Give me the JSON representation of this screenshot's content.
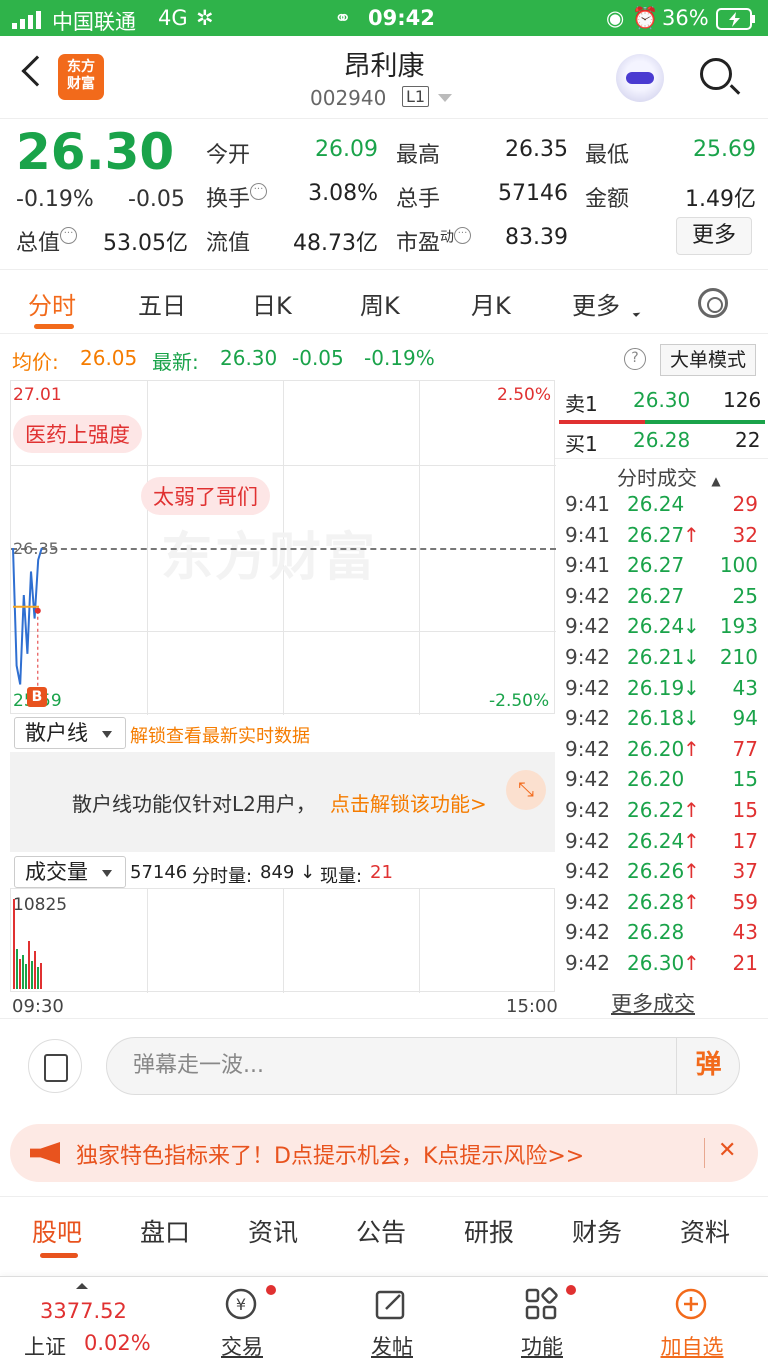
{
  "status_bar": {
    "carrier": "中国联通",
    "network": "4G",
    "time": "09:42",
    "battery": "36%"
  },
  "header": {
    "logo_text": "东方财富",
    "title": "昂利康",
    "code": "002940",
    "level_badge": "L1"
  },
  "quote": {
    "price": "26.30",
    "change_pct": "-0.19%",
    "change": "-0.05",
    "fields": {
      "open_label": "今开",
      "open_value": "26.09",
      "high_label": "最高",
      "high_value": "26.35",
      "low_label": "最低",
      "low_value": "25.69",
      "turnover_label": "换手",
      "turnover_value": "3.08%",
      "volume_label": "总手",
      "volume_value": "57146",
      "amount_label": "金额",
      "amount_value": "1.49亿",
      "mktcap_label": "总值",
      "mktcap_value": "53.05亿",
      "float_label": "流值",
      "float_value": "48.73亿",
      "pe_label": "市盈",
      "pe_sup": "动",
      "pe_value": "83.39"
    },
    "more_label": "更多"
  },
  "tabs": [
    "分时",
    "五日",
    "日K",
    "周K",
    "月K",
    "更多"
  ],
  "info_line": {
    "avg_label": "均价:",
    "avg_value": "26.05",
    "latest_label": "最新:",
    "latest_value": "26.30",
    "latest_change": "-0.05",
    "latest_pct": "-0.19%",
    "help_glyph": "?",
    "big_order_label": "大单模式"
  },
  "chart": {
    "top_price": "27.01",
    "top_pct": "2.50%",
    "bottom_price": "25.59",
    "bottom_pct": "-2.50%",
    "ref_price": "26.35",
    "comments": [
      "医药上强度",
      "太弱了哥们"
    ],
    "watermark": "东方财富",
    "b_marker": "B",
    "start_time": "09:30",
    "end_time": "15:00"
  },
  "chart_data": {
    "type": "line",
    "series": [
      {
        "values": [
          26.3,
          25.8,
          25.72,
          26.1,
          25.85,
          26.2,
          26.0,
          26.25,
          26.3
        ]
      }
    ],
    "ylim": [
      25.59,
      27.01
    ],
    "avg_line": 26.05
  },
  "retail": {
    "select_label": "散户线",
    "unlock_link": "解锁查看最新实时数据",
    "notice": "散户线功能仅针对L2用户，",
    "notice_link": "点击解锁该功能>"
  },
  "volume": {
    "select_label": "成交量",
    "total": "57146",
    "minute_label": "分时量:",
    "minute_value": "849",
    "arrow": "↓",
    "current_label": "现量:",
    "current_value": "21",
    "max_value": "10825"
  },
  "order_book": {
    "sell_label": "卖1",
    "sell_price": "26.30",
    "sell_vol": "126",
    "buy_label": "买1",
    "buy_price": "26.28",
    "buy_vol": "22"
  },
  "ticks_header": "分时成交",
  "ticks": [
    {
      "time": "9:41",
      "price": "26.24",
      "arrow": "",
      "vol": "29",
      "dir": "red"
    },
    {
      "time": "9:41",
      "price": "26.27",
      "arrow": "↑",
      "vol": "32",
      "dir": "red"
    },
    {
      "time": "9:41",
      "price": "26.27",
      "arrow": "",
      "vol": "100",
      "dir": "green"
    },
    {
      "time": "9:42",
      "price": "26.27",
      "arrow": "",
      "vol": "25",
      "dir": "green"
    },
    {
      "time": "9:42",
      "price": "26.24",
      "arrow": "↓",
      "vol": "193",
      "dir": "green"
    },
    {
      "time": "9:42",
      "price": "26.21",
      "arrow": "↓",
      "vol": "210",
      "dir": "green"
    },
    {
      "time": "9:42",
      "price": "26.19",
      "arrow": "↓",
      "vol": "43",
      "dir": "green"
    },
    {
      "time": "9:42",
      "price": "26.18",
      "arrow": "↓",
      "vol": "94",
      "dir": "green"
    },
    {
      "time": "9:42",
      "price": "26.20",
      "arrow": "↑",
      "vol": "77",
      "dir": "red"
    },
    {
      "time": "9:42",
      "price": "26.20",
      "arrow": "",
      "vol": "15",
      "dir": "green"
    },
    {
      "time": "9:42",
      "price": "26.22",
      "arrow": "↑",
      "vol": "15",
      "dir": "red"
    },
    {
      "time": "9:42",
      "price": "26.24",
      "arrow": "↑",
      "vol": "17",
      "dir": "red"
    },
    {
      "time": "9:42",
      "price": "26.26",
      "arrow": "↑",
      "vol": "37",
      "dir": "red"
    },
    {
      "time": "9:42",
      "price": "26.28",
      "arrow": "↑",
      "vol": "59",
      "dir": "red"
    },
    {
      "time": "9:42",
      "price": "26.28",
      "arrow": "",
      "vol": "43",
      "dir": "red"
    },
    {
      "time": "9:42",
      "price": "26.30",
      "arrow": "↑",
      "vol": "21",
      "dir": "red"
    }
  ],
  "more_ticks_label": "更多成交",
  "comment_bar": {
    "placeholder": "弹幕走一波...",
    "send_label": "弹"
  },
  "banner": {
    "text": "独家特色指标来了！D点提示机会，K点提示风险>>",
    "close": "✕"
  },
  "bottom_tabs": [
    "股吧",
    "盘口",
    "资讯",
    "公告",
    "研报",
    "财务",
    "资料"
  ],
  "bottom_nav": {
    "index_value": "3377.52",
    "index_name": "上证",
    "index_pct": "0.02%",
    "trade_label": "交易",
    "post_label": "发帖",
    "func_label": "功能",
    "watch_label": "加自选"
  },
  "colors": {
    "up": "#e03131",
    "down": "#1aa34a",
    "accent": "#f26a1b",
    "status_bar": "#2fb34a"
  }
}
